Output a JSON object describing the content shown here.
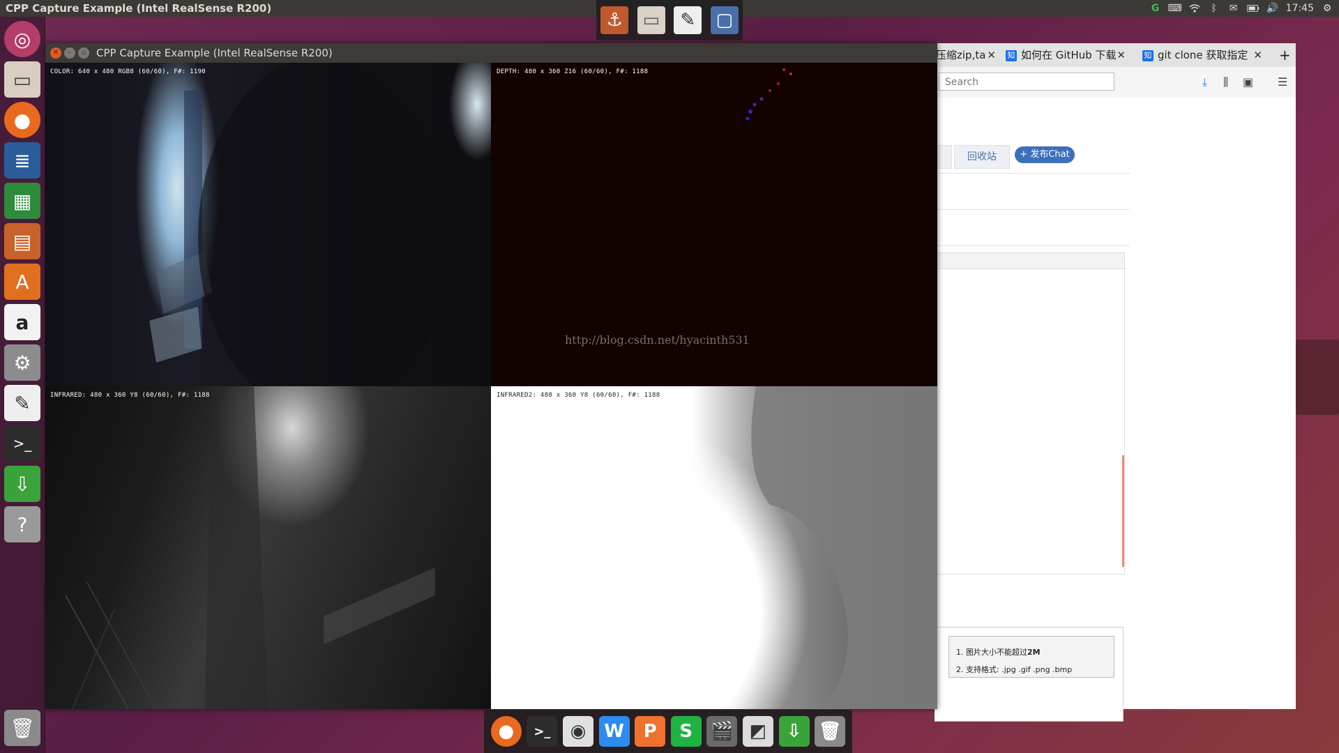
{
  "top_panel": {
    "title": "CPP Capture Example (Intel RealSense R200)",
    "time": "17:45"
  },
  "top_dock": {
    "items": [
      {
        "icon": "anchor-icon"
      },
      {
        "icon": "file-cabinet-icon"
      },
      {
        "icon": "text-editor-icon"
      },
      {
        "icon": "window-icon"
      }
    ]
  },
  "launcher": {
    "items": [
      {
        "icon": "ubuntu-dash-icon"
      },
      {
        "icon": "files-icon"
      },
      {
        "icon": "firefox-icon"
      },
      {
        "icon": "writer-icon"
      },
      {
        "icon": "calc-icon"
      },
      {
        "icon": "impress-icon"
      },
      {
        "icon": "software-center-icon"
      },
      {
        "icon": "amazon-icon"
      },
      {
        "icon": "system-settings-icon"
      },
      {
        "icon": "text-editor-icon"
      },
      {
        "icon": "terminal-icon"
      },
      {
        "icon": "download-icon"
      },
      {
        "icon": "help-icon"
      },
      {
        "icon": "trash-icon"
      }
    ]
  },
  "app_window": {
    "title": "CPP Capture Example (Intel RealSense R200)",
    "quadrants": {
      "color": "COLOR: 640 x 480 RGB8 (60/60), F#: 1190",
      "depth": "DEPTH: 480 x 360 Z16 (60/60), F#: 1188",
      "infrared": "INFRARED: 480 x 360 Y8 (60/60), F#: 1188",
      "infrared2": "INFRARED2: 480 x 360 Y8 (60/60), F#: 1188"
    },
    "watermark": "http://blog.csdn.net/hyacinth531"
  },
  "browser": {
    "tabs": [
      {
        "label": "压缩zip,ta"
      },
      {
        "label": "如何在 GitHub 下载"
      },
      {
        "label": "git clone 获取指定"
      }
    ],
    "tab_badge": "知",
    "search_placeholder": "Search",
    "recycle_tab": "回收站",
    "post_chat": "+ 发布Chat",
    "stray_char": ")",
    "tips": [
      {
        "prefix": "1. 图片大小不能超过",
        "bold": "2M"
      },
      {
        "prefix": "2. 支持格式: .jpg .gif .png .bmp",
        "bold": ""
      }
    ]
  },
  "bottom_dock": {
    "items": [
      {
        "icon": "firefox-icon"
      },
      {
        "icon": "terminal-icon"
      },
      {
        "icon": "audio-player-icon"
      },
      {
        "icon": "wps-writer-icon",
        "glyph": "W"
      },
      {
        "icon": "wps-presentation-icon",
        "glyph": "P"
      },
      {
        "icon": "wps-spreadsheet-icon",
        "glyph": "S"
      },
      {
        "icon": "video-editor-icon"
      },
      {
        "icon": "preview-icon"
      },
      {
        "icon": "download-icon"
      },
      {
        "icon": "trash-icon"
      }
    ]
  }
}
